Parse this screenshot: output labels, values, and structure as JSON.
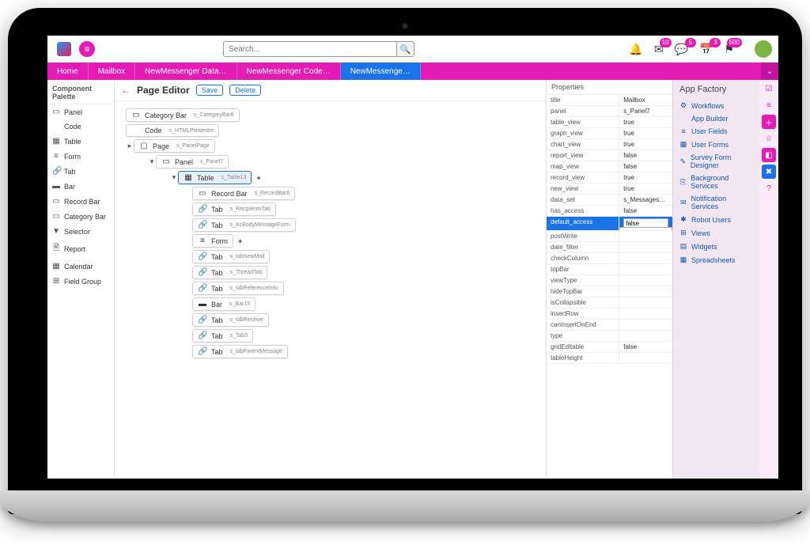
{
  "colors": {
    "accent": "#e41bb5",
    "blue": "#1a73e8"
  },
  "search": {
    "placeholder": "Search..."
  },
  "notifications": {
    "mail": "10",
    "chat": "5",
    "calendar": "3",
    "alert": "500"
  },
  "nav": {
    "items": [
      {
        "label": "Home"
      },
      {
        "label": "Mailbox"
      },
      {
        "label": "NewMessenger Data…"
      },
      {
        "label": "NewMessenger Code…"
      },
      {
        "label": "NewMessenge…",
        "active": true
      }
    ]
  },
  "editor": {
    "title": "Page Editor",
    "save": "Save",
    "delete": "Delete"
  },
  "palette": {
    "header": "Component Palette",
    "items": [
      {
        "icon": "▭",
        "label": "Panel"
      },
      {
        "icon": "</>",
        "label": "Code"
      },
      {
        "icon": "▦",
        "label": "Table"
      },
      {
        "icon": "≡",
        "label": "Form"
      },
      {
        "icon": "🔗",
        "label": "Tab"
      },
      {
        "icon": "▬",
        "label": "Bar"
      },
      {
        "icon": "▭",
        "label": "Record Bar"
      },
      {
        "icon": "▭",
        "label": "Category Bar"
      },
      {
        "icon": "▼",
        "label": "Selector"
      },
      {
        "icon": "🖹",
        "label": "Report"
      },
      {
        "icon": "▦",
        "label": "Calendar"
      },
      {
        "icon": "⊞",
        "label": "Field Group"
      }
    ]
  },
  "tree": [
    {
      "indent": 1,
      "icon": "▭",
      "label": "Category Bar",
      "sub": "s_CategoryBar6"
    },
    {
      "indent": 1,
      "icon": "</>",
      "label": "Code",
      "sub": "s_HTMLPresenter"
    },
    {
      "indent": 1,
      "icon": "▢",
      "label": "Page",
      "sub": "s_PanelPage",
      "twisty": "▸"
    },
    {
      "indent": 2,
      "icon": "▭",
      "label": "Panel",
      "sub": "s_Panel7",
      "twisty": "▾"
    },
    {
      "indent": 3,
      "icon": "▦",
      "label": "Table",
      "sub": "s_Table13",
      "twisty": "▾",
      "selected": true,
      "plus": true
    },
    {
      "indent": 4,
      "icon": "▭",
      "label": "Record Bar",
      "sub": "s_RecordBar6"
    },
    {
      "indent": 4,
      "icon": "🔗",
      "label": "Tab",
      "sub": "s_RecipientsTab"
    },
    {
      "indent": 4,
      "icon": "🔗",
      "label": "Tab",
      "sub": "s_AcBodyMessageForm"
    },
    {
      "indent": 4,
      "icon": "≡",
      "label": "Form",
      "sub": "",
      "plus": true
    },
    {
      "indent": 4,
      "icon": "🔗",
      "label": "Tab",
      "sub": "s_tabNewMail"
    },
    {
      "indent": 4,
      "icon": "🔗",
      "label": "Tab",
      "sub": "s_ThreadTab"
    },
    {
      "indent": 4,
      "icon": "🔗",
      "label": "Tab",
      "sub": "s_tabReferenceInfo"
    },
    {
      "indent": 4,
      "icon": "▬",
      "label": "Bar",
      "sub": "s_Bar15"
    },
    {
      "indent": 4,
      "icon": "🔗",
      "label": "Tab",
      "sub": "s_tabReceive"
    },
    {
      "indent": 4,
      "icon": "🔗",
      "label": "Tab",
      "sub": "s_Tab3"
    },
    {
      "indent": 4,
      "icon": "🔗",
      "label": "Tab",
      "sub": "s_tabParentMessage"
    }
  ],
  "properties": {
    "header": "Properties",
    "rows": [
      {
        "k": "title",
        "v": "Mailbox"
      },
      {
        "k": "panel",
        "v": "s_Panel7"
      },
      {
        "k": "table_view",
        "v": "true"
      },
      {
        "k": "graph_view",
        "v": "true"
      },
      {
        "k": "chart_view",
        "v": "true"
      },
      {
        "k": "report_view",
        "v": "false"
      },
      {
        "k": "map_view",
        "v": "false"
      },
      {
        "k": "record_view",
        "v": "true"
      },
      {
        "k": "new_view",
        "v": "true"
      },
      {
        "k": "data_set",
        "v": "s_MessagesSet"
      },
      {
        "k": "has_access",
        "v": "false"
      },
      {
        "k": "default_access",
        "v": "false",
        "editing": true
      },
      {
        "k": "postWrite",
        "v": ""
      },
      {
        "k": "date_filter",
        "v": ""
      },
      {
        "k": "checkColumn",
        "v": ""
      },
      {
        "k": "topBar",
        "v": ""
      },
      {
        "k": "viewType",
        "v": ""
      },
      {
        "k": "hideTopBar",
        "v": ""
      },
      {
        "k": "isCollapsible",
        "v": ""
      },
      {
        "k": "insertRow",
        "v": ""
      },
      {
        "k": "canInsertOnEnd",
        "v": ""
      },
      {
        "k": "type",
        "v": ""
      },
      {
        "k": "gridEditable",
        "v": "false"
      },
      {
        "k": "tableHeight",
        "v": ""
      }
    ],
    "dropdown_options": [
      "true",
      "false"
    ]
  },
  "factory": {
    "title": "App Factory",
    "items": [
      {
        "icon": "⚙",
        "label": "Workflows"
      },
      {
        "icon": "</>",
        "label": "App Builder"
      },
      {
        "icon": "≡",
        "label": "User Fields"
      },
      {
        "icon": "▦",
        "label": "User Forms"
      },
      {
        "icon": "✎",
        "label": "Survey Form Designer"
      },
      {
        "icon": "⎘",
        "label": "Background Services"
      },
      {
        "icon": "✉",
        "label": "Notification Services"
      },
      {
        "icon": "✱",
        "label": "Robot Users"
      },
      {
        "icon": "⊞",
        "label": "Views"
      },
      {
        "icon": "▤",
        "label": "Widgets"
      },
      {
        "icon": "▦",
        "label": "Spreadsheets"
      }
    ]
  },
  "iconrail": [
    {
      "glyph": "☑",
      "style": "plain"
    },
    {
      "glyph": "≡",
      "style": "plain"
    },
    {
      "glyph": "＋",
      "style": "solid"
    },
    {
      "glyph": "☆",
      "style": "plain"
    },
    {
      "glyph": "◧",
      "style": "solid"
    },
    {
      "glyph": "✖",
      "style": "blue"
    },
    {
      "glyph": "?",
      "style": "plain"
    }
  ]
}
